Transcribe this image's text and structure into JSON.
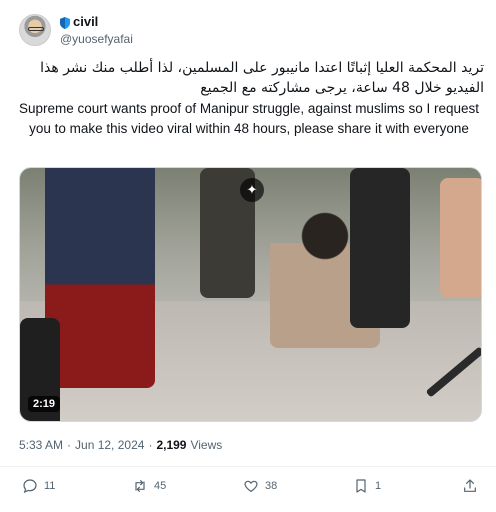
{
  "author": {
    "display_name": "civil",
    "handle": "@yuosefyafai",
    "badge_icon": "shield-icon"
  },
  "tweet": {
    "text_arabic": "تريد المحكمة العليا إثباتًا اعتدا مانيبور على المسلمين، لذا أطلب منك نشر هذا الفيديو خلال 48 ساعة، يرجى مشاركته مع الجميع",
    "text_english": "Supreme court wants proof of Manipur struggle, against muslims so I request you to make this video viral within 48 hours, please share it with everyone"
  },
  "media": {
    "duration": "2:19",
    "grok_icon": "sparkle-icon"
  },
  "meta": {
    "time": "5:33 AM",
    "separator": "·",
    "date": "Jun 12, 2024",
    "views_count": "2,199",
    "views_label": "Views"
  },
  "actions": {
    "replies": "11",
    "retweets": "45",
    "likes": "38",
    "bookmarks": "1"
  },
  "colors": {
    "text_primary": "#0f1419",
    "text_secondary": "#536471",
    "badge_blue": "#1d9bf0"
  }
}
